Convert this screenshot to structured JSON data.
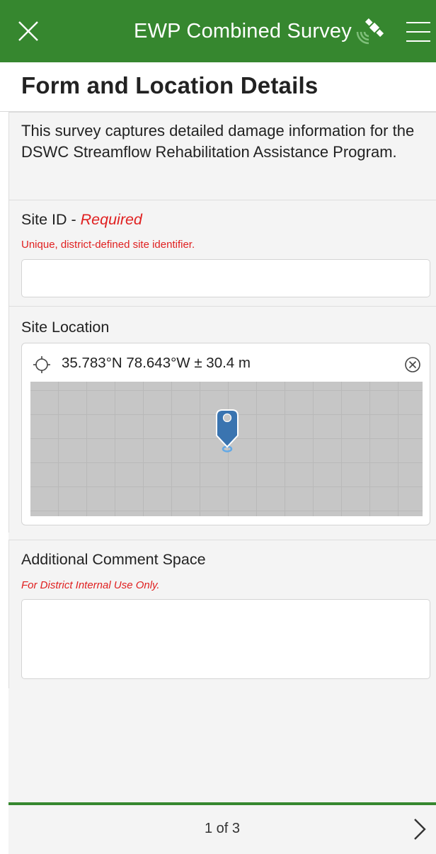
{
  "header": {
    "title": "EWP Combined Survey",
    "close_icon": "close-icon",
    "gps_icon": "satellite-icon",
    "menu_icon": "menu-icon",
    "bg_color": "#36872f"
  },
  "page": {
    "title": "Form and Location Details",
    "description": "This survey captures detailed damage information for the DSWC Streamflow Rehabilitation Assistance Program."
  },
  "fields": {
    "site_id": {
      "label": "Site ID - ",
      "required_label": "Required",
      "hint": "Unique, district-defined site identifier.",
      "value": ""
    },
    "site_location": {
      "label": "Site Location",
      "coordinates": "35.783°N 78.643°W ± 30.4 m"
    },
    "comment": {
      "label": "Additional Comment Space",
      "hint": "For District Internal Use Only.",
      "value": ""
    }
  },
  "footer": {
    "page_indicator": "1 of 3",
    "next_icon": "chevron-right-icon",
    "accent_color": "#36872f"
  },
  "colors": {
    "required": "#e02020"
  }
}
